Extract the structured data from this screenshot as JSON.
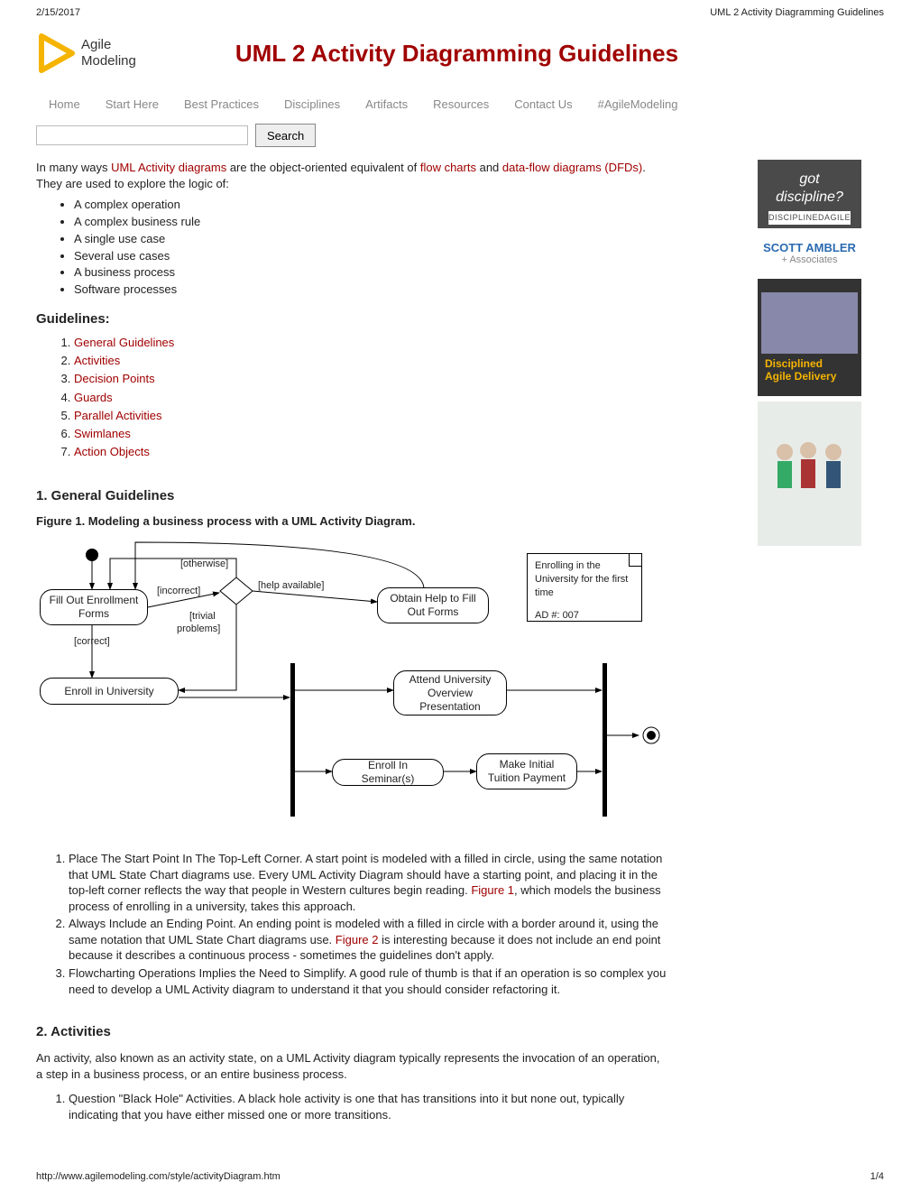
{
  "print": {
    "date": "2/15/2017",
    "doctitle": "UML 2 Activity Diagramming Guidelines"
  },
  "logo": {
    "line1": "Agile",
    "line2": "Modeling"
  },
  "title": "UML 2 Activity Diagramming Guidelines",
  "nav": [
    "Home",
    "Start Here",
    "Best Practices",
    "Disciplines",
    "Artifacts",
    "Resources",
    "Contact Us",
    "#AgileModeling"
  ],
  "search": {
    "button": "Search"
  },
  "intro": {
    "pre": "In many ways ",
    "link1": "UML Activity diagrams",
    "mid1": " are the object-oriented equivalent of ",
    "link2": "flow charts",
    "mid2": " and ",
    "link3": "data-flow diagrams (DFDs)",
    "post": ". They are used to explore the logic of:"
  },
  "logic_items": [
    "A complex operation",
    "A complex business rule",
    "A single use case",
    "Several use cases",
    "A business process",
    "Software processes"
  ],
  "guidelines_heading": "Guidelines:",
  "guidelines_items": [
    "General Guidelines",
    "Activities",
    "Decision Points",
    "Guards",
    "Parallel Activities",
    "Swimlanes",
    "Action Objects"
  ],
  "section1": {
    "heading": "1. General Guidelines",
    "figure": "Figure 1. Modeling a business process with a UML Activity Diagram."
  },
  "diagram": {
    "box_fillout": "Fill Out Enrollment Forms",
    "box_enroll": "Enroll in University",
    "box_obtain": "Obtain Help to Fill Out Forms",
    "box_attend": "Attend University Overview Presentation",
    "box_seminar": "Enroll In Seminar(s)",
    "box_payment": "Make Initial Tuition Payment",
    "lbl_otherwise": "[otherwise]",
    "lbl_incorrect": "[incorrect]",
    "lbl_correct": "[correct]",
    "lbl_help": "[help   available]",
    "lbl_trivial1": "[trivial",
    "lbl_trivial2": "problems]",
    "note_l1": "Enrolling in the",
    "note_l2": "University for the first",
    "note_l3": "time",
    "note_id": "AD #: 007"
  },
  "rules1": [
    {
      "pre": "Place The Start Point In The Top-Left Corner. A start point is modeled with a filled in circle, using the same notation that UML State Chart diagrams use. Every UML Activity Diagram should have a starting point, and placing it in the top-left corner reflects the way that people in Western cultures begin reading. ",
      "link": "Figure 1",
      "post": ", which models the business process of enrolling in a university, takes this approach."
    },
    {
      "pre": "Always Include an Ending Point. An ending point is modeled with a filled in circle with a border around it, using the same notation that UML State Chart diagrams use. ",
      "link": "Figure 2",
      "post": " is interesting because it does not include an end point because it describes a continuous process - sometimes the guidelines don't apply."
    },
    {
      "pre": "Flowcharting Operations Implies the Need to Simplify. A good rule of thumb is that if an operation is so complex you need to develop a UML Activity diagram to understand it that you should consider refactoring it.",
      "link": "",
      "post": ""
    }
  ],
  "section2": {
    "heading": "2. Activities",
    "para": "An activity, also known as an activity state, on a UML Activity diagram typically represents the invocation of an operation, a step in a business process, or an entire business process.",
    "rule1": "Question \"Black Hole\" Activities. A black hole activity is one that has transitions into it but none out, typically indicating that you have either missed one or more transitions."
  },
  "ads": {
    "a1a": "got",
    "a1b": "discipline?",
    "a1c": "DISCIPLINEDAGILE",
    "a2a": "SCOTT AMBLER",
    "a2b": "+ Associates",
    "a3t": "Disciplined",
    "a3u": "Agile Delivery"
  },
  "footer": {
    "url": "http://www.agilemodeling.com/style/activityDiagram.htm",
    "page": "1/4"
  }
}
